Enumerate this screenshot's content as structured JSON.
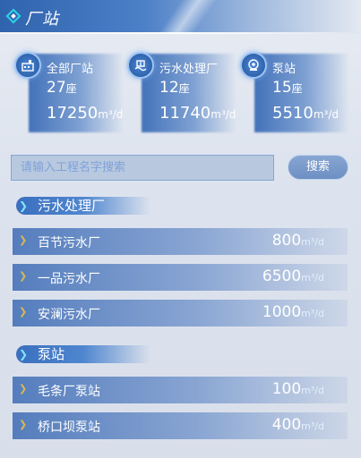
{
  "header": {
    "title": "厂站"
  },
  "stats": [
    {
      "name": "全部厂站",
      "count": "27",
      "count_unit": "座",
      "capacity": "17250",
      "capacity_unit": "m³/d",
      "icon": "factory-icon"
    },
    {
      "name": "污水处理厂",
      "count": "12",
      "count_unit": "座",
      "capacity": "11740",
      "capacity_unit": "m³/d",
      "icon": "treatment-plant-icon"
    },
    {
      "name": "泵站",
      "count": "15",
      "count_unit": "座",
      "capacity": "5510",
      "capacity_unit": "m³/d",
      "icon": "pump-icon"
    }
  ],
  "search": {
    "placeholder": "请输入工程名字搜索",
    "button": "搜索"
  },
  "sections": [
    {
      "title": "污水处理厂",
      "items": [
        {
          "name": "百节污水厂",
          "value": "800",
          "unit": "m³/d"
        },
        {
          "name": "一品污水厂",
          "value": "6500",
          "unit": "m³/d"
        },
        {
          "name": "安澜污水厂",
          "value": "1000",
          "unit": "m³/d"
        }
      ]
    },
    {
      "title": "泵站",
      "items": [
        {
          "name": "毛条厂泵站",
          "value": "100",
          "unit": "m³/d"
        },
        {
          "name": "桥口坝泵站",
          "value": "400",
          "unit": "m³/d"
        }
      ]
    }
  ],
  "colors": {
    "accent": "#2f63ad",
    "highlight": "#2fd3e6",
    "arrow": "#d7b954"
  }
}
